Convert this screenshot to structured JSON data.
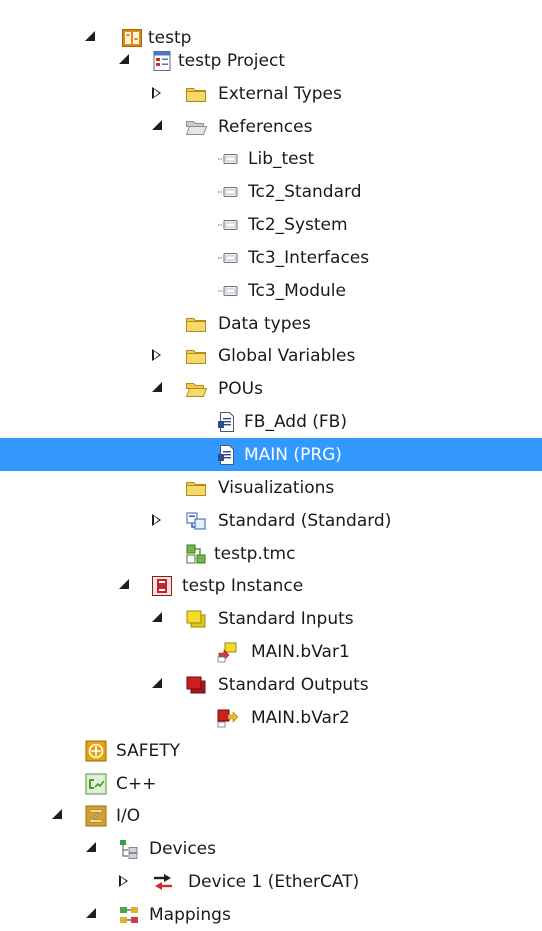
{
  "tree": {
    "items": [
      {
        "label": "testp",
        "icon": "plc-project-icon",
        "toggle": "expanded",
        "selected": false
      },
      {
        "label": "testp Project",
        "icon": "plc-project-file-icon",
        "toggle": "expanded",
        "selected": false
      },
      {
        "label": "External Types",
        "icon": "folder-icon",
        "toggle": "collapsed",
        "selected": false
      },
      {
        "label": "References",
        "icon": "folder-open-gray-icon",
        "toggle": "expanded",
        "selected": false
      },
      {
        "label": "Lib_test",
        "icon": "library-reference-icon",
        "toggle": "none",
        "selected": false
      },
      {
        "label": "Tc2_Standard",
        "icon": "library-reference-icon",
        "toggle": "none",
        "selected": false
      },
      {
        "label": "Tc2_System",
        "icon": "library-reference-icon",
        "toggle": "none",
        "selected": false
      },
      {
        "label": "Tc3_Interfaces",
        "icon": "library-reference-icon",
        "toggle": "none",
        "selected": false
      },
      {
        "label": "Tc3_Module",
        "icon": "library-reference-icon",
        "toggle": "none",
        "selected": false
      },
      {
        "label": "Data types",
        "icon": "folder-icon",
        "toggle": "none",
        "selected": false
      },
      {
        "label": "Global Variables",
        "icon": "folder-icon",
        "toggle": "collapsed",
        "selected": false
      },
      {
        "label": "POUs",
        "icon": "folder-open-icon",
        "toggle": "expanded",
        "selected": false
      },
      {
        "label": "FB_Add (FB)",
        "icon": "pou-document-icon",
        "toggle": "none",
        "selected": false
      },
      {
        "label": "MAIN (PRG)",
        "icon": "pou-document-icon",
        "toggle": "none",
        "selected": true
      },
      {
        "label": "Visualizations",
        "icon": "folder-icon",
        "toggle": "none",
        "selected": false
      },
      {
        "label": "Standard (Standard)",
        "icon": "task-reference-icon",
        "toggle": "collapsed",
        "selected": false
      },
      {
        "label": "testp.tmc",
        "icon": "tmc-file-icon",
        "toggle": "none",
        "selected": false
      },
      {
        "label": "testp Instance",
        "icon": "plc-instance-icon",
        "toggle": "expanded",
        "selected": false
      },
      {
        "label": "Standard Inputs",
        "icon": "inputs-icon",
        "toggle": "expanded",
        "selected": false
      },
      {
        "label": "MAIN.bVar1",
        "icon": "input-variable-icon",
        "toggle": "none",
        "selected": false
      },
      {
        "label": "Standard Outputs",
        "icon": "outputs-icon",
        "toggle": "expanded",
        "selected": false
      },
      {
        "label": "MAIN.bVar2",
        "icon": "output-variable-icon",
        "toggle": "none",
        "selected": false
      },
      {
        "label": "SAFETY",
        "icon": "safety-icon",
        "toggle": "none",
        "selected": false
      },
      {
        "label": "C++",
        "icon": "cpp-icon",
        "toggle": "none",
        "selected": false
      },
      {
        "label": "I/O",
        "icon": "io-icon",
        "toggle": "expanded",
        "selected": false
      },
      {
        "label": "Devices",
        "icon": "devices-icon",
        "toggle": "expanded",
        "selected": false
      },
      {
        "label": "Device 1 (EtherCAT)",
        "icon": "ethercat-device-icon",
        "toggle": "collapsed",
        "selected": false
      },
      {
        "label": "Mappings",
        "icon": "mappings-icon",
        "toggle": "expanded",
        "selected": false
      }
    ]
  },
  "colors": {
    "selection": "#3399ff",
    "folder": "#f2c94c",
    "inputs": "#f3dc2c",
    "outputs": "#cc1f1f",
    "plc": "#d98a1b",
    "instance": "#c0262c",
    "safety": "#e3a50f",
    "cpp": "#4d9a33",
    "io": "#d6a02a"
  }
}
